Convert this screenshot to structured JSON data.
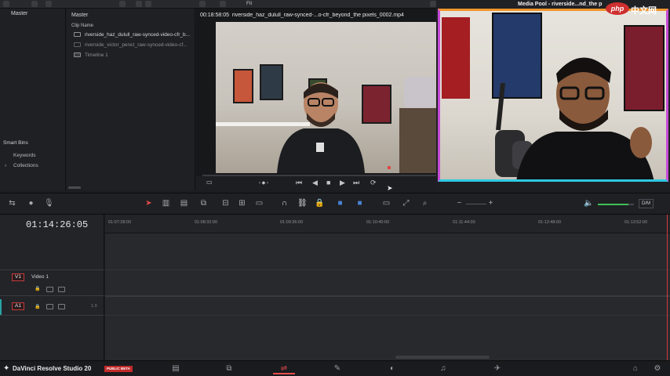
{
  "colors": {
    "accent": "#e64c4c",
    "overlay_top": "#f0962e",
    "overlay_bottom": "#2ec9e3",
    "overlay_side": "#c64bd6"
  },
  "toolbar": {
    "fit_label": "Fit"
  },
  "bins": {
    "master_label": "Master",
    "smart_bins_label": "Smart Bins",
    "keywords_label": "Keywords",
    "collections_label": "Collections"
  },
  "media_pool": {
    "header": "Master",
    "column_header": "Clip Name",
    "clips": [
      {
        "name": "riverside_haz_dulull_raw-synced-video-cfr_b..."
      },
      {
        "name": "riverside_victor_perez_raw-synced-video-cf..."
      },
      {
        "name": "Timeline 1"
      }
    ]
  },
  "viewer": {
    "timecode": "00:18:58:05",
    "clip_title": "riverside_haz_dulull_raw-synced-...o-cfr_beyond_the pixels_0002.mp4"
  },
  "source_viewer": {
    "title": "Media Pool - riverside...nd_the p"
  },
  "watermark": {
    "logo": "php",
    "text": "中文网"
  },
  "timeline": {
    "timecode": "01:14:26:05",
    "ruler": [
      "01:07:28:00",
      "01:08:32:00",
      "01:09:36:00",
      "01:10:40:00",
      "01:11:44:00",
      "01:12:48:00",
      "01:13:52:00"
    ],
    "tracks": [
      {
        "badge": "V1",
        "name": "Video 1"
      },
      {
        "badge": "A1",
        "name": "",
        "level": "1.0"
      }
    ]
  },
  "status": {
    "product": "DaVinci Resolve Studio 20",
    "beta_badge": "PUBLIC BETA"
  },
  "pages": [
    {
      "icon": "media-page-icon",
      "glyph": "▤"
    },
    {
      "icon": "cut-page-icon",
      "glyph": "⧉"
    },
    {
      "icon": "edit-page-icon",
      "glyph": "⇌"
    },
    {
      "icon": "fusion-page-icon",
      "glyph": "✎"
    },
    {
      "icon": "color-page-icon",
      "glyph": "◐"
    },
    {
      "icon": "fairlight-page-icon",
      "glyph": "♫"
    },
    {
      "icon": "deliver-page-icon",
      "glyph": "✈"
    }
  ],
  "volume_level_percent": 85,
  "zoom_mode": "D/M"
}
